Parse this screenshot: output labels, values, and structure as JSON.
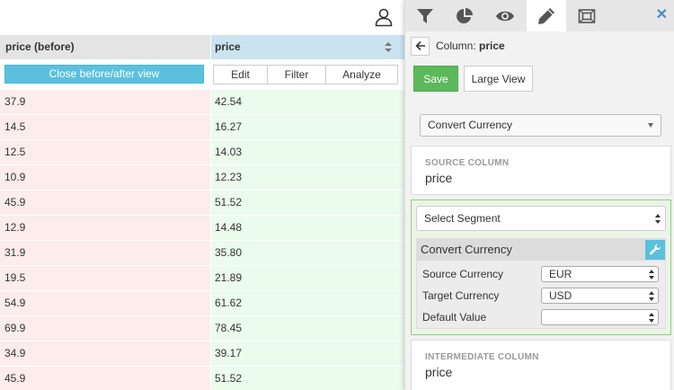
{
  "grid": {
    "col_before": "price (before)",
    "col_after": "price",
    "close_view_label": "Close before/after view",
    "actions": {
      "edit": "Edit",
      "filter": "Filter",
      "analyze": "Analyze"
    },
    "rows": [
      {
        "before": "37.9",
        "after": "42.54"
      },
      {
        "before": "14.5",
        "after": "16.27"
      },
      {
        "before": "12.5",
        "after": "14.03"
      },
      {
        "before": "10.9",
        "after": "12.23"
      },
      {
        "before": "45.9",
        "after": "51.52"
      },
      {
        "before": "12.9",
        "after": "14.48"
      },
      {
        "before": "31.9",
        "after": "35.80"
      },
      {
        "before": "19.5",
        "after": "21.89"
      },
      {
        "before": "54.9",
        "after": "61.62"
      },
      {
        "before": "69.9",
        "after": "78.45"
      },
      {
        "before": "34.9",
        "after": "39.17"
      },
      {
        "before": "45.9",
        "after": "51.52"
      }
    ]
  },
  "panel": {
    "tabs": [
      "filter-icon",
      "pie-chart-icon",
      "eye-icon",
      "pencil-icon",
      "frame-icon"
    ],
    "active_tab": "pencil-icon",
    "close_glyph": "✕",
    "column_prefix": "Column:",
    "column_name": "price",
    "save_label": "Save",
    "large_view_label": "Large View",
    "transform_selected": "Convert Currency",
    "source_column_label": "SOURCE COLUMN",
    "source_column_value": "price",
    "segment_placeholder": "Select Segment",
    "convert_title": "Convert Currency",
    "params": {
      "source_currency_label": "Source Currency",
      "source_currency_value": "EUR",
      "target_currency_label": "Target Currency",
      "target_currency_value": "USD",
      "default_value_label": "Default Value",
      "default_value_value": ""
    },
    "intermediate_column_label": "INTERMEDIATE COLUMN",
    "intermediate_column_value": "price"
  },
  "colors": {
    "accent_blue": "#5bc0de",
    "save_green": "#5cb85c",
    "before_bg": "#fcecec",
    "after_bg": "#ebfbec",
    "header_after_bg": "#c9e3f0"
  }
}
